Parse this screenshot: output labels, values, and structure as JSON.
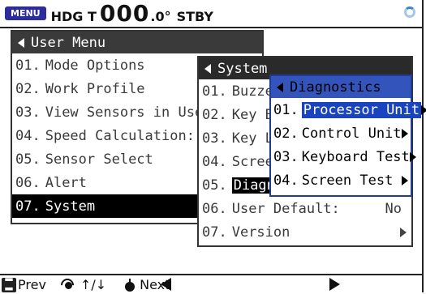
{
  "status_bar": {
    "menu_key": "MENU",
    "heading_label": "HDG T",
    "heading_value": "000",
    "heading_decimal": ".0°",
    "mode": "STBY"
  },
  "user_menu": {
    "title": "User Menu",
    "items": [
      {
        "num": "01.",
        "label": "Mode Options"
      },
      {
        "num": "02.",
        "label": "Work Profile"
      },
      {
        "num": "03.",
        "label": "View Sensors in Use"
      },
      {
        "num": "04.",
        "label": "Speed Calculation:"
      },
      {
        "num": "05.",
        "label": "Sensor Select"
      },
      {
        "num": "06.",
        "label": "Alert"
      },
      {
        "num": "07.",
        "label": "System"
      }
    ]
  },
  "system_menu": {
    "title": "System",
    "items": [
      {
        "num": "01.",
        "label": "Buzzer"
      },
      {
        "num": "02.",
        "label": "Key Beep"
      },
      {
        "num": "03.",
        "label": "Key Lock"
      },
      {
        "num": "04.",
        "label": "Screen"
      },
      {
        "num": "05.",
        "label": "Diagnostics"
      },
      {
        "num": "06.",
        "label": "User Default:",
        "value": "No"
      },
      {
        "num": "07.",
        "label": "Version"
      }
    ]
  },
  "diagnostics_menu": {
    "title": "Diagnostics",
    "items": [
      {
        "num": "01.",
        "label": "Processor Unit"
      },
      {
        "num": "02.",
        "label": "Control Unit"
      },
      {
        "num": "03.",
        "label": "Keyboard Test"
      },
      {
        "num": "04.",
        "label": "Screen Test"
      }
    ]
  },
  "footer": {
    "prev": "Prev",
    "updown": "↑/↓",
    "next": "Next"
  },
  "colors": {
    "menu_key": "#2c2c9a",
    "diagnostics_header": "#3355bb",
    "diagnostics_selection": "#1a43c0"
  }
}
